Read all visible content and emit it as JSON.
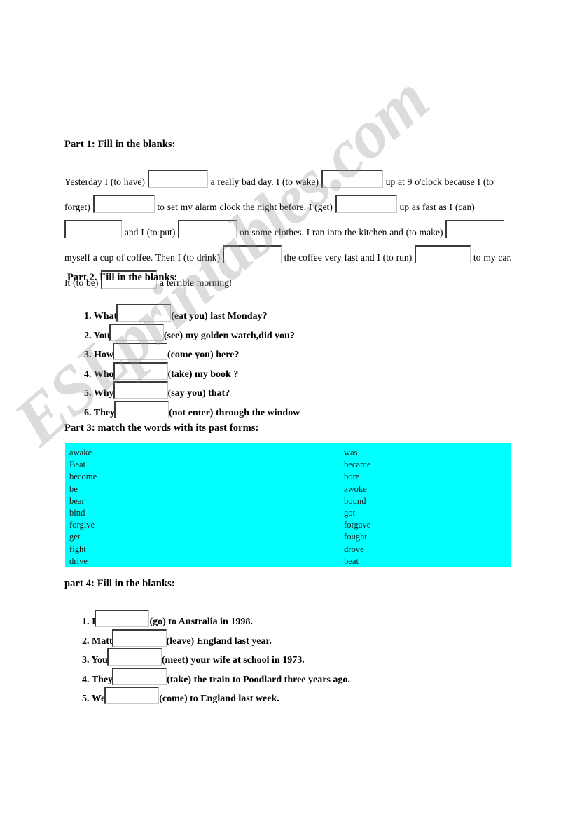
{
  "document": {
    "watermark": "ESLprintables.com",
    "background_color": "#ffffff",
    "highlight_color": "#00ffff"
  },
  "part1": {
    "heading": "Part 1: Fill in the blanks:",
    "segments": [
      "Yesterday I (to have)",
      "a really bad day. I (to wake)",
      "up at 9 o'clock because I (to forget)",
      "to set my alarm clock the night before. I (get)",
      "up as fast as I (can)",
      "and I (to put)",
      "on some clothes. I ran into the kitchen and (to make)",
      "myself a cup of coffee. Then I (to drink)",
      "the coffee very fast and I (to run)",
      "to my car. It (to be)",
      "a terrible morning!"
    ]
  },
  "part2": {
    "heading": "Part 2. Fill in the blanks:",
    "items": [
      {
        "number": "1.",
        "before": "What",
        "after": "(eat you) last Monday?"
      },
      {
        "number": "2.",
        "before": "You",
        "after": "(see) my golden watch,did you?"
      },
      {
        "number": "3.",
        "before": "How",
        "after": "(come you) here?"
      },
      {
        "number": "4.",
        "before": "Who",
        "after": "(take) my book ?"
      },
      {
        "number": "5.",
        "before": "Why",
        "after": "(say you) that?"
      },
      {
        "number": "6.",
        "before": "They",
        "after": "(not enter) through the window"
      }
    ]
  },
  "part3": {
    "heading": "Part 3: match the words with its past forms:",
    "left_column": [
      "awake",
      "Beat",
      "become",
      "be",
      "bear",
      "bind",
      "forgive",
      "get",
      "fight",
      "drive"
    ],
    "right_column": [
      "was",
      "became",
      "bore",
      "awoke",
      "bound",
      "got",
      "forgave",
      "fought",
      "drove",
      "beat"
    ]
  },
  "part4": {
    "heading": "part 4: Fill in the blanks:",
    "items": [
      {
        "number": "1.",
        "before": "I",
        "after": "(go) to Australia in 1998."
      },
      {
        "number": "2.",
        "before": "Matt",
        "after": "(leave) England last year."
      },
      {
        "number": "3.",
        "before": "You",
        "after": "(meet) your wife at school in 1973."
      },
      {
        "number": "4.",
        "before": "They",
        "after": "(take) the train to Poodlard three years ago."
      },
      {
        "number": "5.",
        "before": "We",
        "after": "(come) to England last week."
      }
    ]
  }
}
